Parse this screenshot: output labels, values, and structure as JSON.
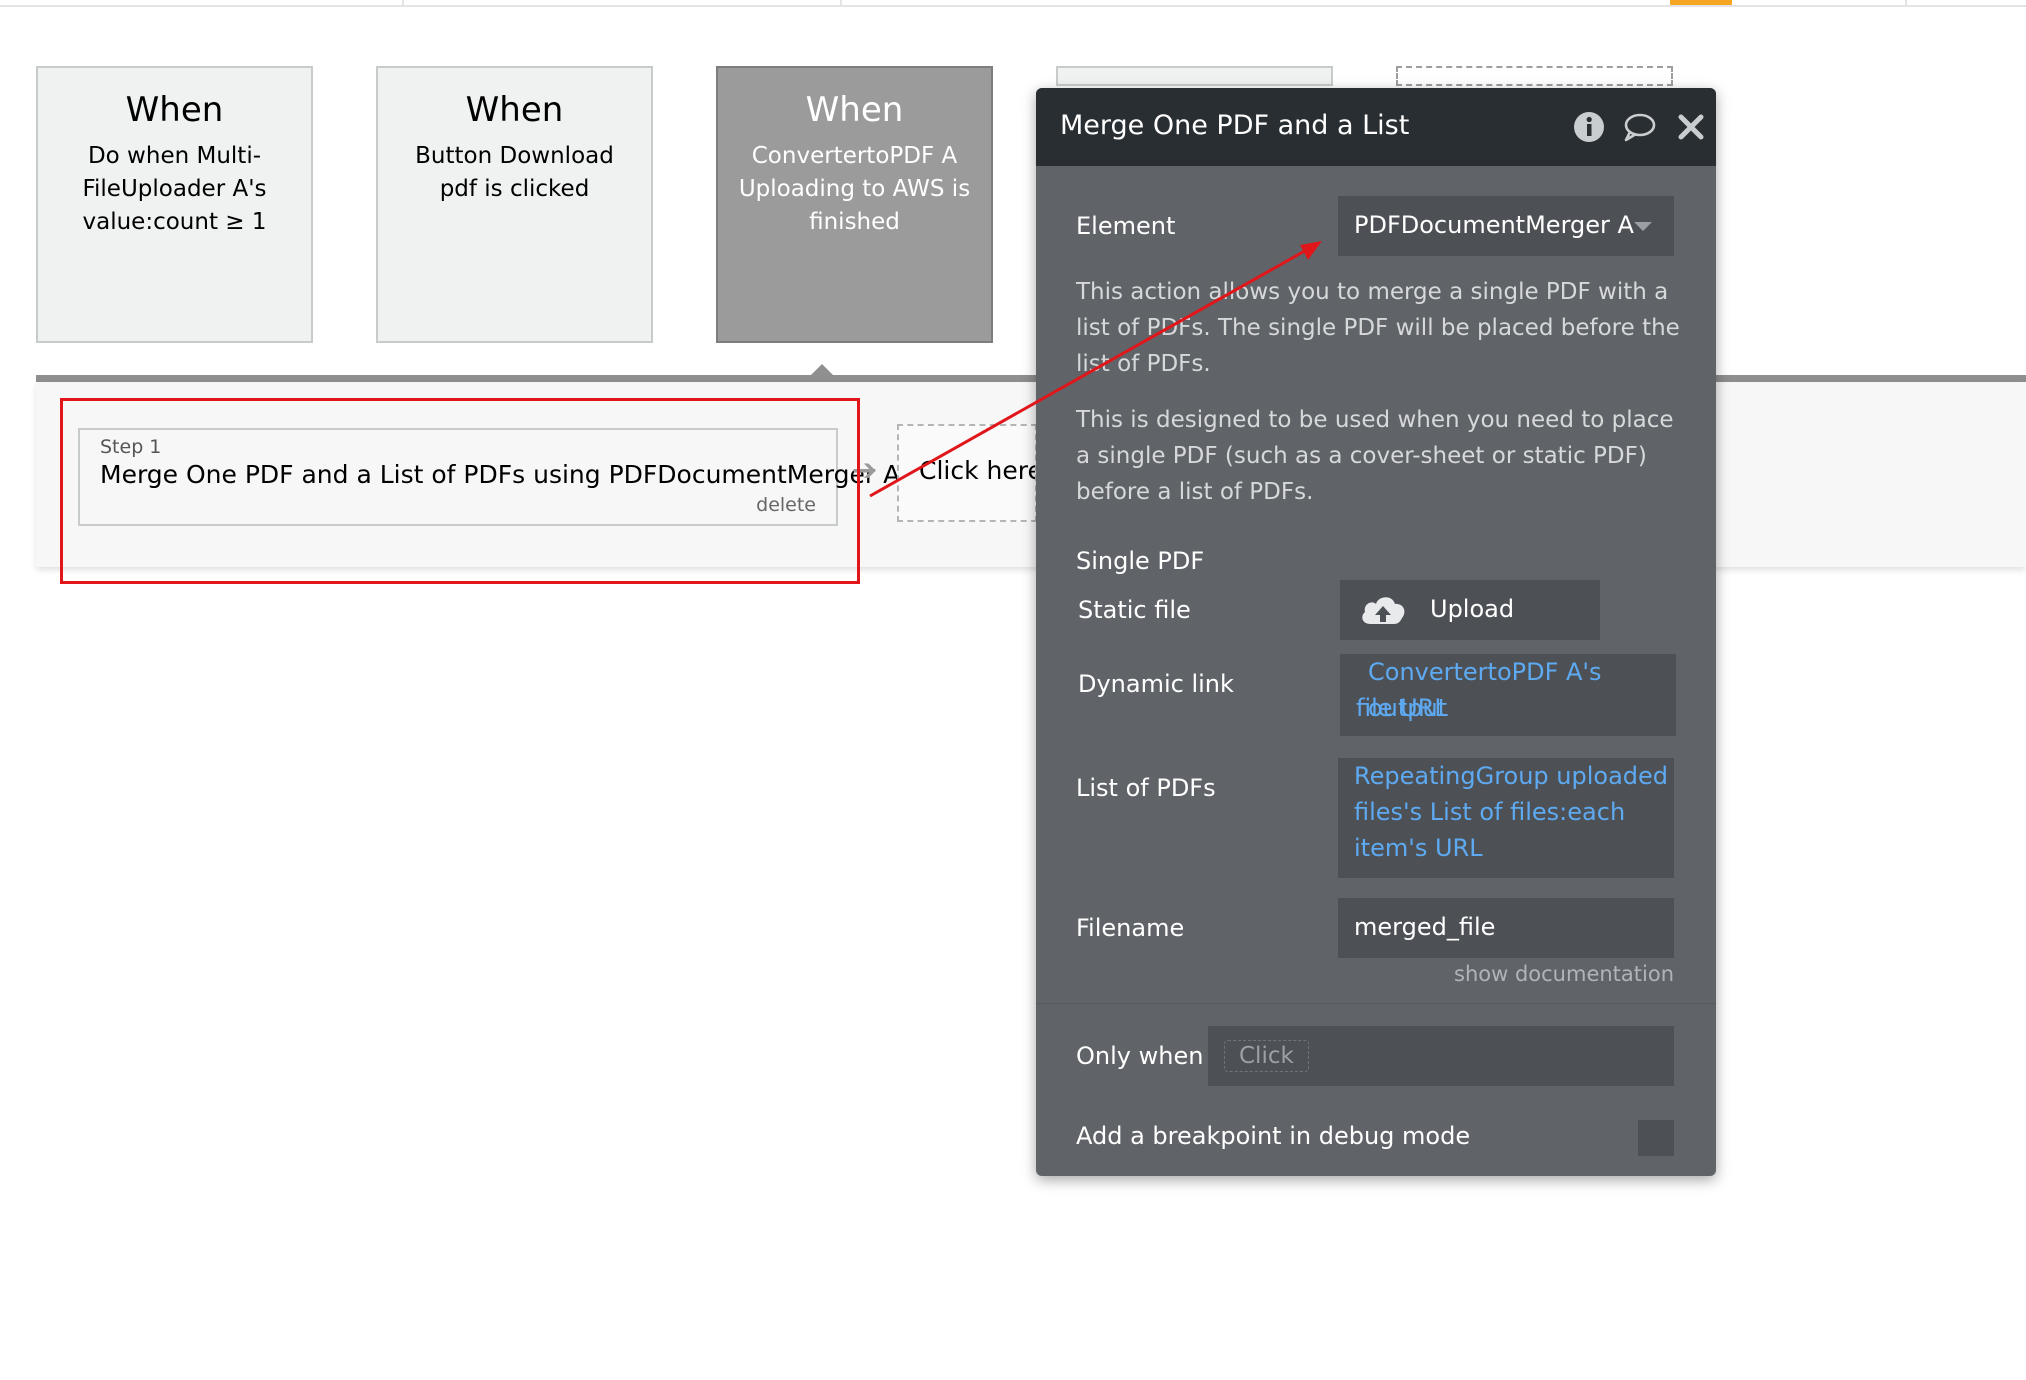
{
  "events": [
    {
      "when": "When",
      "description": "Do when Multi-FileUploader A's value:count ≥ 1"
    },
    {
      "when": "When",
      "description": "Button Download pdf is clicked"
    },
    {
      "when": "When",
      "description": "ConvertertoPDF A Uploading to AWS is finished"
    }
  ],
  "workflow": {
    "step_number": "Step 1",
    "step_title": "Merge One PDF and a List of PDFs using PDFDocumentMerger A",
    "delete_label": "delete",
    "add_step_label": "Click here t"
  },
  "panel": {
    "title": "Merge One PDF and a List of PDFs using PDFDocumentMerger A",
    "element_label": "Element",
    "element_value": "PDFDocumentMerger A",
    "description_1": "This action allows you to merge a single PDF with a list of PDFs. The single PDF will be placed before the list of PDFs.",
    "description_2": "This is designed to be used when you need to place a single PDF (such as a cover-sheet or static PDF) before a list of PDFs.",
    "single_pdf_label": "Single PDF",
    "static_file_label": "Static file",
    "upload_label": "Upload",
    "dynamic_link_label": "Dynamic link",
    "dynamic_link_value_line1": "ConvertertoPDF A's output",
    "dynamic_link_value_line2": "file URL",
    "list_of_pdfs_label": "List of PDFs",
    "list_of_pdfs_line1": "RepeatingGroup uploaded",
    "list_of_pdfs_line2": "files's List of files:each",
    "list_of_pdfs_line3": "item's URL",
    "filename_label": "Filename",
    "filename_value": "merged_file",
    "show_documentation": "show documentation",
    "only_when_label": "Only when",
    "only_when_placeholder": "Click",
    "breakpoint_label": "Add a breakpoint in debug mode"
  },
  "icons": {
    "info": "info-icon",
    "comment": "comment-icon",
    "close": "close-icon",
    "upload": "cloud-upload-icon",
    "arrow": "arrow-right-icon"
  },
  "colors": {
    "panel_bg": "#606468",
    "panel_header": "#292e32",
    "link": "#5eaaf2",
    "highlight": "#e0161b",
    "selected_event": "#9b9b9b"
  }
}
